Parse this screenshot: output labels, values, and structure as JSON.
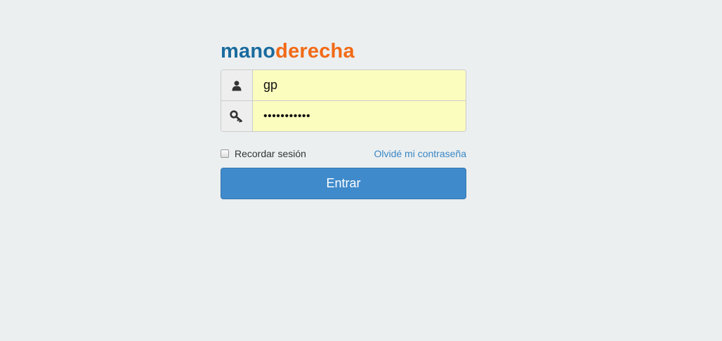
{
  "logo": {
    "part1": "mano",
    "part2": "derecha"
  },
  "login": {
    "username_value": "gp",
    "password_value": "•••••••••••",
    "user_icon": "user-icon",
    "key_icon": "key-icon"
  },
  "options": {
    "remember_label": "Recordar sesión",
    "forgot_label": "Olvidé mi contraseña"
  },
  "submit": {
    "label": "Entrar"
  },
  "colors": {
    "background": "#ebeff0",
    "logo_blue": "#1a6b9e",
    "logo_orange": "#f26a16",
    "input_fill": "#fbfdbe",
    "button": "#3f8acb",
    "link": "#3a86c4"
  }
}
